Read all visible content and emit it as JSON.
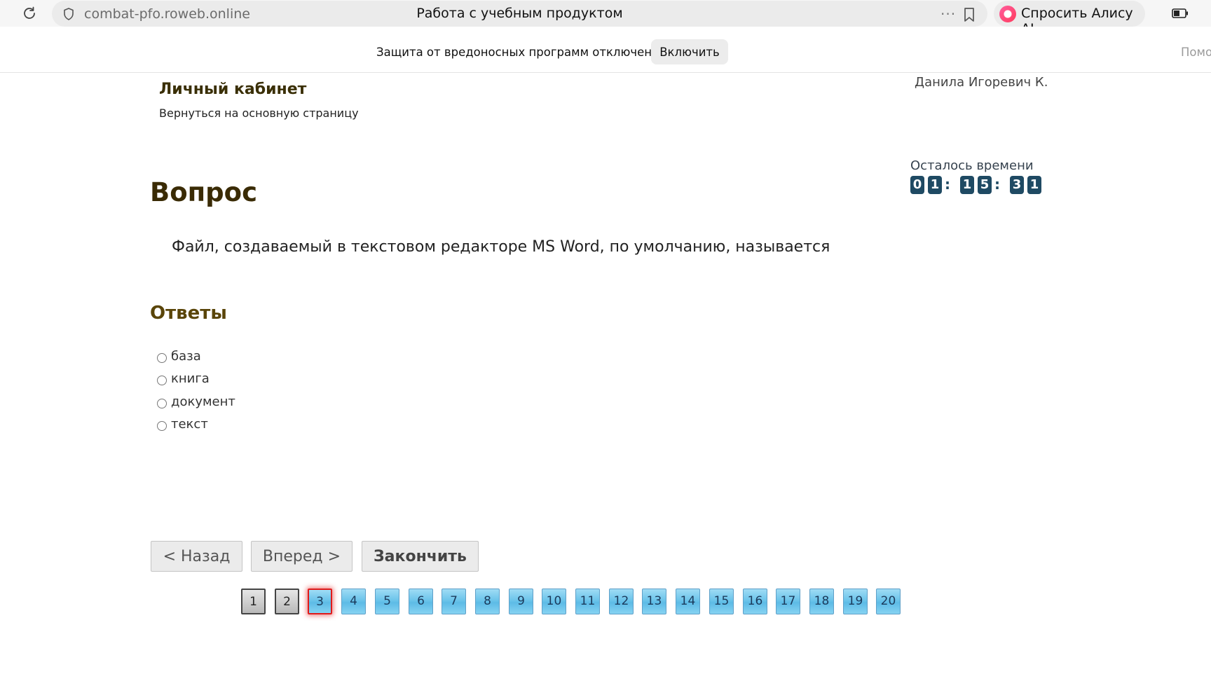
{
  "browser": {
    "url": "combat-pfo.roweb.online",
    "page_title": "Работа с учебным продуктом",
    "more_icon": "···",
    "alice_label": "Спросить Алису AI"
  },
  "infobar": {
    "message": "Защита от вредоносных программ отключена",
    "enable_label": "Включить",
    "help_label": "Помо"
  },
  "header": {
    "title": "Личный кабинет",
    "back_link": "Вернуться на основную страницу",
    "user_name": "Данила Игоревич К."
  },
  "timer": {
    "label": "Осталось времени",
    "digits": [
      "0",
      "1",
      "1",
      "5",
      "3",
      "1"
    ],
    "separator": ":"
  },
  "question": {
    "heading": "Вопрос",
    "text": "Файл, создаваемый в текстовом редакторе MS Word, по умолчанию, называется"
  },
  "answers": {
    "heading": "Ответы",
    "options": [
      "база",
      "книга",
      "документ",
      "текст"
    ]
  },
  "nav": {
    "back_label": "< Назад",
    "forward_label": "Вперед >",
    "finish_label": "Закончить"
  },
  "pagination": {
    "pages": [
      "1",
      "2",
      "3",
      "4",
      "5",
      "6",
      "7",
      "8",
      "9",
      "10",
      "11",
      "12",
      "13",
      "14",
      "15",
      "16",
      "17",
      "18",
      "19",
      "20"
    ],
    "current": "3",
    "answered": [
      "1",
      "2"
    ]
  }
}
